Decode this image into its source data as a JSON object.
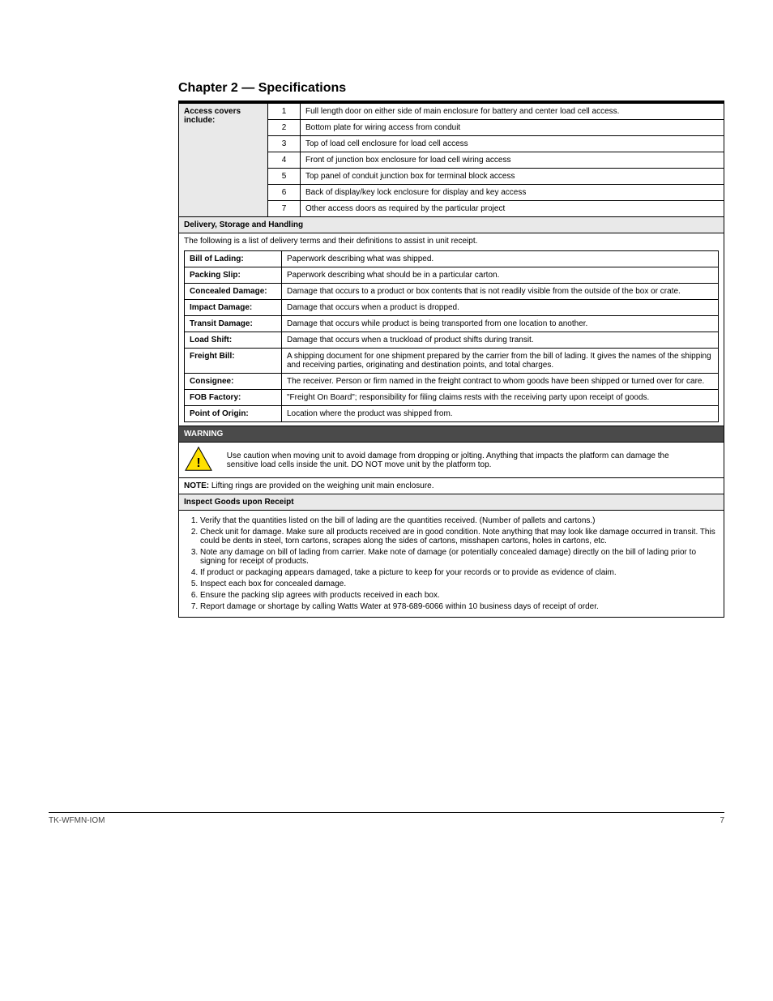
{
  "page_title": "Chapter 2 — Specifications",
  "access": {
    "header": "Access covers include:",
    "rows": [
      {
        "id": "1",
        "text": "Full length door on either side of main enclosure for battery and center load cell access."
      },
      {
        "id": "2",
        "text": "Bottom plate for wiring access from conduit"
      },
      {
        "id": "3",
        "text": "Top of load cell enclosure for load cell access"
      },
      {
        "id": "4",
        "text": "Front of junction box enclosure for load cell wiring access"
      },
      {
        "id": "5",
        "text": "Top panel of conduit junction box for terminal block access"
      },
      {
        "id": "6",
        "text": "Back of display/key lock enclosure for display and key access"
      },
      {
        "id": "7",
        "text": "Other access doors as required by the particular project"
      }
    ]
  },
  "delivery": {
    "header": "Delivery, Storage and Handling",
    "intro": "The following is a list of delivery terms and their definitions to assist in unit receipt.",
    "terms": [
      {
        "t": "Bill of Lading:",
        "d": "Paperwork describing what was shipped."
      },
      {
        "t": "Packing Slip:",
        "d": "Paperwork describing what should be in a particular carton."
      },
      {
        "t": "Concealed Damage:",
        "d": "Damage that occurs to a product or box contents that is not readily visible from the outside of the box or crate."
      },
      {
        "t": "Impact Damage:",
        "d": "Damage that occurs when a product is dropped."
      },
      {
        "t": "Transit Damage:",
        "d": "Damage that occurs while product is being transported from one location to another."
      },
      {
        "t": "Load Shift:",
        "d": "Damage that occurs when a truckload of product shifts during transit."
      },
      {
        "t": "Freight Bill:",
        "d": "A shipping document for one shipment prepared by the carrier from the bill of lading. It gives the names of the shipping and receiving parties, originating and destination points, and total charges."
      },
      {
        "t": "Consignee:",
        "d": "The receiver. Person or firm named in the freight contract to whom goods have been shipped or turned over for care."
      },
      {
        "t": "FOB Factory:",
        "d": "\"Freight On Board\"; responsibility for filing claims rests with the receiving party upon receipt of goods."
      },
      {
        "t": "Point of Origin:",
        "d": "Location where the product was shipped from."
      }
    ]
  },
  "warning": {
    "bar": "WARNING",
    "text": "Use caution when moving unit to avoid damage from dropping or jolting. Anything that impacts the platform can damage the sensitive load cells inside the unit. DO NOT move unit by the platform top.",
    "note_label": "NOTE:",
    "note_text": "Lifting rings are provided on the weighing unit main enclosure."
  },
  "instructions": {
    "header": "Inspect Goods upon Receipt",
    "steps": [
      "Verify that the quantities listed on the bill of lading are the quantities received. (Number of pallets and cartons.)",
      "Check unit for damage. Make sure all products received are in good condition. Note anything that may look like damage occurred in transit. This could be dents in steel, torn cartons, scrapes along the sides of cartons, misshapen cartons, holes in cartons, etc.",
      "Note any damage on bill of lading from carrier. Make note of damage (or potentially concealed damage) directly on the bill of lading prior to signing for receipt of products.",
      "If product or packaging appears damaged, take a picture to keep for your records or to provide as evidence of claim.",
      "Inspect each box for concealed damage.",
      "Ensure the packing slip agrees with products received in each box.",
      "Report damage or shortage by calling Watts Water at 978-689-6066 within 10 business days of receipt of order."
    ]
  },
  "footer": {
    "left": "TK-WFMN-IOM",
    "right": "7"
  }
}
